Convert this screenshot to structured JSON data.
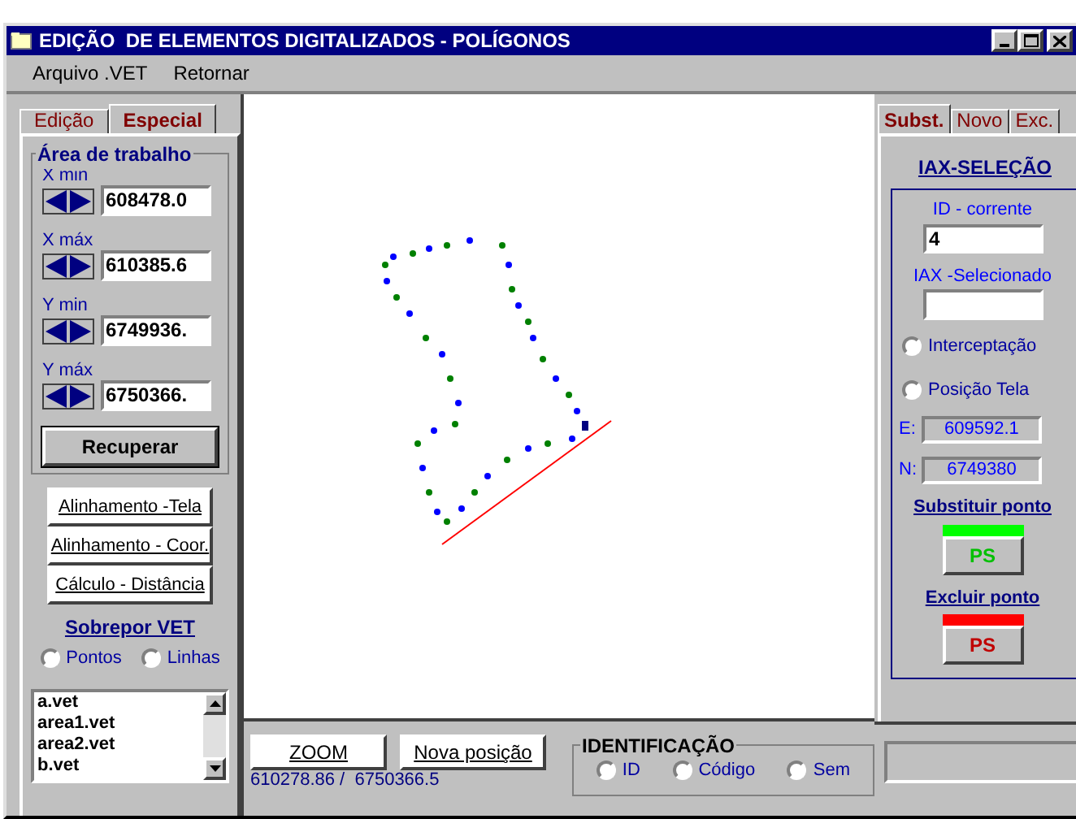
{
  "window": {
    "title": "EDIÇÃO  DE ELEMENTOS DIGITALIZADOS - POLÍGONOS"
  },
  "menu": [
    "Arquivo .VET",
    "Retornar"
  ],
  "left_tabs": [
    {
      "label": "Edição",
      "selected": false
    },
    {
      "label": "Especial",
      "selected": true
    }
  ],
  "work_area": {
    "title": "Área de trabalho",
    "fields": [
      {
        "caption": "X min",
        "value": "608478.0"
      },
      {
        "caption": "X máx",
        "value": "610385.6"
      },
      {
        "caption": "Y min",
        "value": "6749936."
      },
      {
        "caption": "Y máx",
        "value": "6750366."
      }
    ],
    "button": "Recuperar"
  },
  "tool_buttons": [
    "Alinhamento -Tela",
    "Alinhamento - Coor.",
    "Cálculo - Distância"
  ],
  "overlay": {
    "title": "Sobrepor VET",
    "options": [
      {
        "label": "Pontos",
        "selected": false
      },
      {
        "label": "Linhas",
        "selected": false
      }
    ],
    "files": [
      "a.vet",
      "area1.vet",
      "area2.vet",
      "b.vet"
    ]
  },
  "right_tabs": [
    {
      "label": "Subst.",
      "selected": true
    },
    {
      "label": "Novo",
      "selected": false
    },
    {
      "label": "Exc.",
      "selected": false
    }
  ],
  "selection": {
    "title": "IAX-SELEÇÃO",
    "id_label": "ID - corrente",
    "id_value": "4",
    "iax_label": "IAX -Selecionado",
    "options": [
      {
        "label": "Interceptação",
        "selected": false
      },
      {
        "label": "Posição Tela",
        "selected": false
      }
    ],
    "e_label": "E:",
    "e_value": "609592.1",
    "n_label": "N:",
    "n_value": "6749380",
    "actions": [
      {
        "title": "Substituir ponto",
        "button": "PS",
        "color": "#00ff00"
      },
      {
        "title": "Excluir ponto",
        "button": "PS",
        "color": "#ff0000"
      }
    ]
  },
  "bottom": {
    "zoom": "ZOOM",
    "new_position": "Nova posição",
    "coords": "610278.86 /  6750366.5",
    "identification": {
      "title": "IDENTIFICAÇÃO",
      "options": [
        {
          "label": "ID",
          "selected": false
        },
        {
          "label": "Código",
          "selected": false
        },
        {
          "label": "Sem",
          "selected": false
        }
      ]
    }
  }
}
